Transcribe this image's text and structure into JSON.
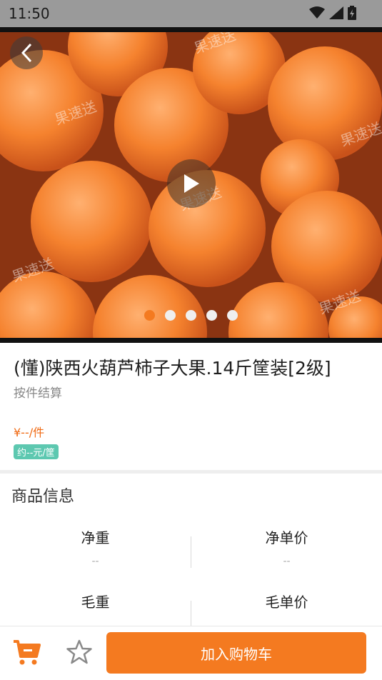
{
  "status_bar": {
    "time": "11:50"
  },
  "hero": {
    "watermark": "果速送",
    "carousel": {
      "count": 5,
      "active_index": 0
    }
  },
  "product": {
    "title": "(懂)陕西火葫芦柿子大果.14斤筐装[2级]",
    "subtitle": "按件结算",
    "price": "¥--/件",
    "approx_price": "约--元/筐"
  },
  "spec": {
    "title": "商品信息",
    "items": [
      {
        "label": "净重",
        "value": "--"
      },
      {
        "label": "净单价",
        "value": "--"
      },
      {
        "label": "毛重",
        "value": ""
      },
      {
        "label": "毛单价",
        "value": ""
      }
    ]
  },
  "bottom_bar": {
    "add_to_cart_label": "加入购物车"
  },
  "colors": {
    "accent": "#f47a20",
    "tag": "#5dc8b0"
  },
  "icons": [
    "back-icon",
    "play-icon",
    "cart-icon",
    "star-icon",
    "wifi-icon",
    "signal-icon",
    "battery-icon"
  ]
}
